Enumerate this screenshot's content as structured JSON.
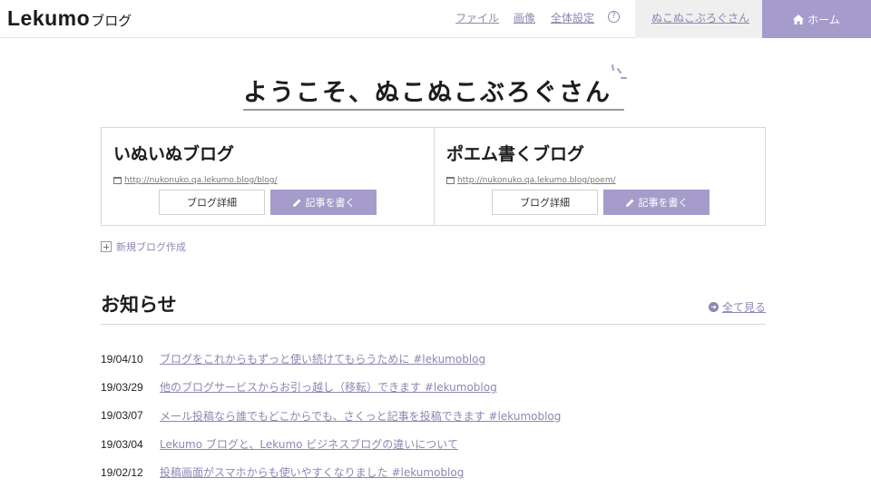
{
  "header": {
    "logo_main": "Lekumo",
    "logo_sub": "ブログ",
    "nav": [
      "ファイル",
      "画像",
      "全体設定"
    ],
    "help": "?",
    "user": "ぬこぬこぶろぐさん",
    "home": "ホーム"
  },
  "welcome": "ようこそ、ぬこぬこぶろぐさん",
  "blogs": [
    {
      "title": "いぬいぬブログ",
      "url": "http://nukonuko.qa.lekumo.blog/blog/",
      "detail_label": "ブログ詳細",
      "write_label": "記事を書く"
    },
    {
      "title": "ポエム書くブログ",
      "url": "http://nukonuko.qa.lekumo.blog/poem/",
      "detail_label": "ブログ詳細",
      "write_label": "記事を書く"
    }
  ],
  "new_blog": "新規ブログ作成",
  "news": {
    "title": "お知らせ",
    "see_all": "全て見る",
    "items": [
      {
        "date": "19/04/10",
        "text": "ブログをこれからもずっと使い続けてもらうために #lekumoblog"
      },
      {
        "date": "19/03/29",
        "text": "他のブログサービスからお引っ越し（移転）できます #lekumoblog"
      },
      {
        "date": "19/03/07",
        "text": "メール投稿なら誰でもどこからでも、さくっと記事を投稿できます #lekumoblog"
      },
      {
        "date": "19/03/04",
        "text": "Lekumo ブログと、Lekumo ビジネスブログの違いについて"
      },
      {
        "date": "19/02/12",
        "text": "投稿画面がスマホからも使いやすくなりました #lekumoblog"
      }
    ]
  },
  "colors": {
    "accent": "#a59ccb",
    "link": "#8f86b3"
  }
}
